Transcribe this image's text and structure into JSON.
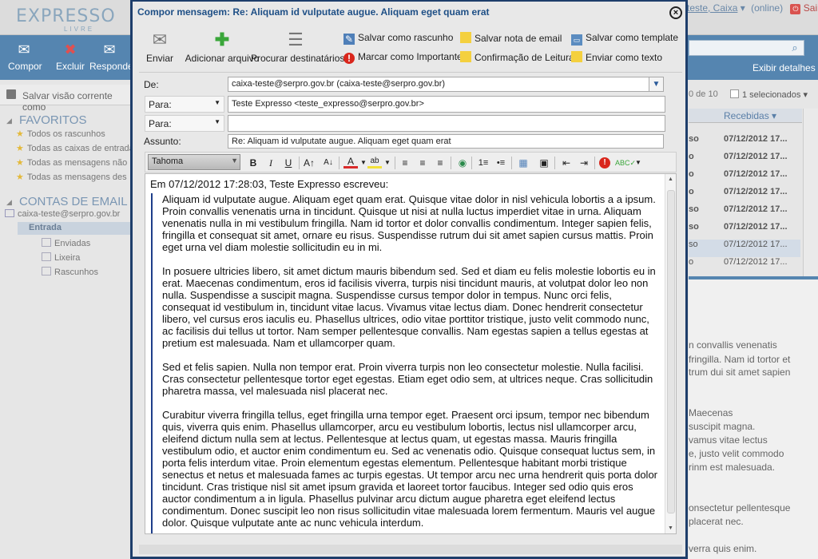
{
  "app": {
    "logo": "EXPRESSO",
    "logo_sub": "LIVRE",
    "user": "teste, Caixa",
    "status": "(online)",
    "logout": "Sair",
    "toolbar": {
      "compor": "Compor",
      "excluir": "Excluir",
      "responder": "Responde"
    },
    "exibir_detalhes": "Exibir detalhes",
    "save_view": "Salvar visão corrente como",
    "pagination": "0 de 10",
    "selecionados": "1 selecionados",
    "col_recebidas": "Recebidas",
    "favoritos_title": "FAVORITOS",
    "favoritos": [
      "Todos os rascunhos",
      "Todas as caixas de entrada",
      "Todas as mensagens não",
      "Todas as mensagens des"
    ],
    "contas_title": "CONTAS DE EMAIL",
    "account": "caixa-teste@serpro.gov.br",
    "folders": {
      "entrada": "Entrada",
      "enviadas": "Enviadas",
      "lixeira": "Lixeira",
      "rascunhos": "Rascunhos"
    },
    "rows": [
      {
        "from": "so",
        "date": "07/12/2012 17..."
      },
      {
        "from": "o",
        "date": "07/12/2012 17..."
      },
      {
        "from": "o",
        "date": "07/12/2012 17..."
      },
      {
        "from": "o",
        "date": "07/12/2012 17..."
      },
      {
        "from": "so",
        "date": "07/12/2012 17..."
      },
      {
        "from": "so",
        "date": "07/12/2012 17..."
      },
      {
        "from": "so",
        "date": "07/12/2012 17..."
      },
      {
        "from": "o",
        "date": "07/12/2012 17..."
      },
      {
        "from": "o",
        "date": "07/12/2012 17..."
      }
    ],
    "preview_lines": [
      "n convallis venenatis",
      "fringilla. Nam id tortor et",
      "trum dui sit amet sapien",
      "Maecenas",
      "suscipit magna.",
      "vamus vitae lectus",
      "e, justo velit commodo",
      "rinm est malesuada.",
      "onsectetur pellentesque",
      "placerat nec.",
      "verra quis enim."
    ]
  },
  "dialog": {
    "title": "Compor mensagem: Re: Aliquam id vulputate augue. Aliquam eget quam erat",
    "close": "×",
    "btn_enviar": "Enviar",
    "btn_anexar": "Adicionar arquivo",
    "btn_destinatarios": "Procurar destinatários",
    "btn_rascunho": "Salvar como rascunho",
    "btn_nota": "Salvar nota de email",
    "btn_template": "Salvar como template",
    "btn_importante": "Marcar como Importante",
    "btn_confirmacao": "Confirmação de Leitura",
    "btn_texto": "Enviar como texto",
    "de_label": "De:",
    "de_value": "caixa-teste@serpro.gov.br (caixa-teste@serpro.gov.br)",
    "para_label": "Para:",
    "para_value": "Teste Expresso <teste_expresso@serpro.gov.br>",
    "para2_label": "Para:",
    "para2_value": "",
    "assunto_label": "Assunto:",
    "assunto_value": "Re: Aliquam id vulputate augue. Aliquam eget quam erat",
    "font": "Tahoma",
    "intro": "Em 07/12/2012 17:28:03, Teste Expresso escreveu:",
    "paragraphs": [
      "Aliquam id vulputate augue. Aliquam eget quam erat. Quisque vitae dolor in nisl vehicula lobortis a a ipsum. Proin convallis venenatis urna in tincidunt. Quisque ut nisi at nulla luctus imperdiet vitae in urna. Aliquam venenatis nulla in mi vestibulum fringilla. Nam id tortor et dolor convallis condimentum. Integer sapien felis, fringilla et consequat sit amet, ornare eu risus. Suspendisse rutrum dui sit amet sapien cursus mattis. Proin eget urna vel diam molestie sollicitudin eu in mi.",
      "In posuere ultricies libero, sit amet dictum mauris bibendum sed. Sed et diam eu felis molestie lobortis eu in erat. Maecenas condimentum, eros id facilisis viverra, turpis nisi tincidunt mauris, at volutpat dolor leo non nulla. Suspendisse a suscipit magna. Suspendisse cursus tempor dolor in tempus. Nunc orci felis, consequat id vestibulum in, tincidunt vitae lacus. Vivamus vitae lectus diam. Donec hendrerit consectetur libero, vel cursus eros iaculis eu. Phasellus ultrices, odio vitae porttitor tristique, justo velit commodo nunc, ac facilisis dui tellus ut tortor. Nam semper pellentesque convallis. Nam egestas sapien a tellus egestas at pretium est malesuada. Nam et ullamcorper quam.",
      "Sed et felis sapien. Nulla non tempor erat. Proin viverra turpis non leo consectetur molestie. Nulla facilisi. Cras consectetur pellentesque tortor eget egestas. Etiam eget odio sem, at ultrices neque. Cras sollicitudin pharetra massa, vel malesuada nisl placerat nec.",
      "Curabitur viverra fringilla tellus, eget fringilla urna tempor eget. Praesent orci ipsum, tempor nec bibendum quis, viverra quis enim. Phasellus ullamcorper, arcu eu vestibulum lobortis, lectus nisl ullamcorper arcu, eleifend dictum nulla sem at lectus. Pellentesque at lectus quam, ut egestas massa. Mauris fringilla vestibulum odio, et auctor enim condimentum eu. Sed ac venenatis odio. Quisque consequat luctus sem, in porta felis interdum vitae. Proin elementum egestas elementum. Pellentesque habitant morbi tristique senectus et netus et malesuada fames ac turpis egestas. Ut tempor arcu nec urna hendrerit quis porta dolor tincidunt. Cras tristique nisl sit amet ipsum gravida et laoreet tortor faucibus. Integer sed odio quis eros auctor condimentum a in ligula. Phasellus pulvinar arcu dictum augue pharetra eget eleifend lectus condimentum. Donec suscipit leo non risus sollicitudin vitae malesuada lorem fermentum. Mauris vel augue dolor. Quisque vulputate ante ac nunc vehicula interdum."
    ]
  },
  "colors": {
    "accent": "#5585b0",
    "title_blue": "#1e4f86",
    "dialog_border": "#1e3e6b"
  }
}
